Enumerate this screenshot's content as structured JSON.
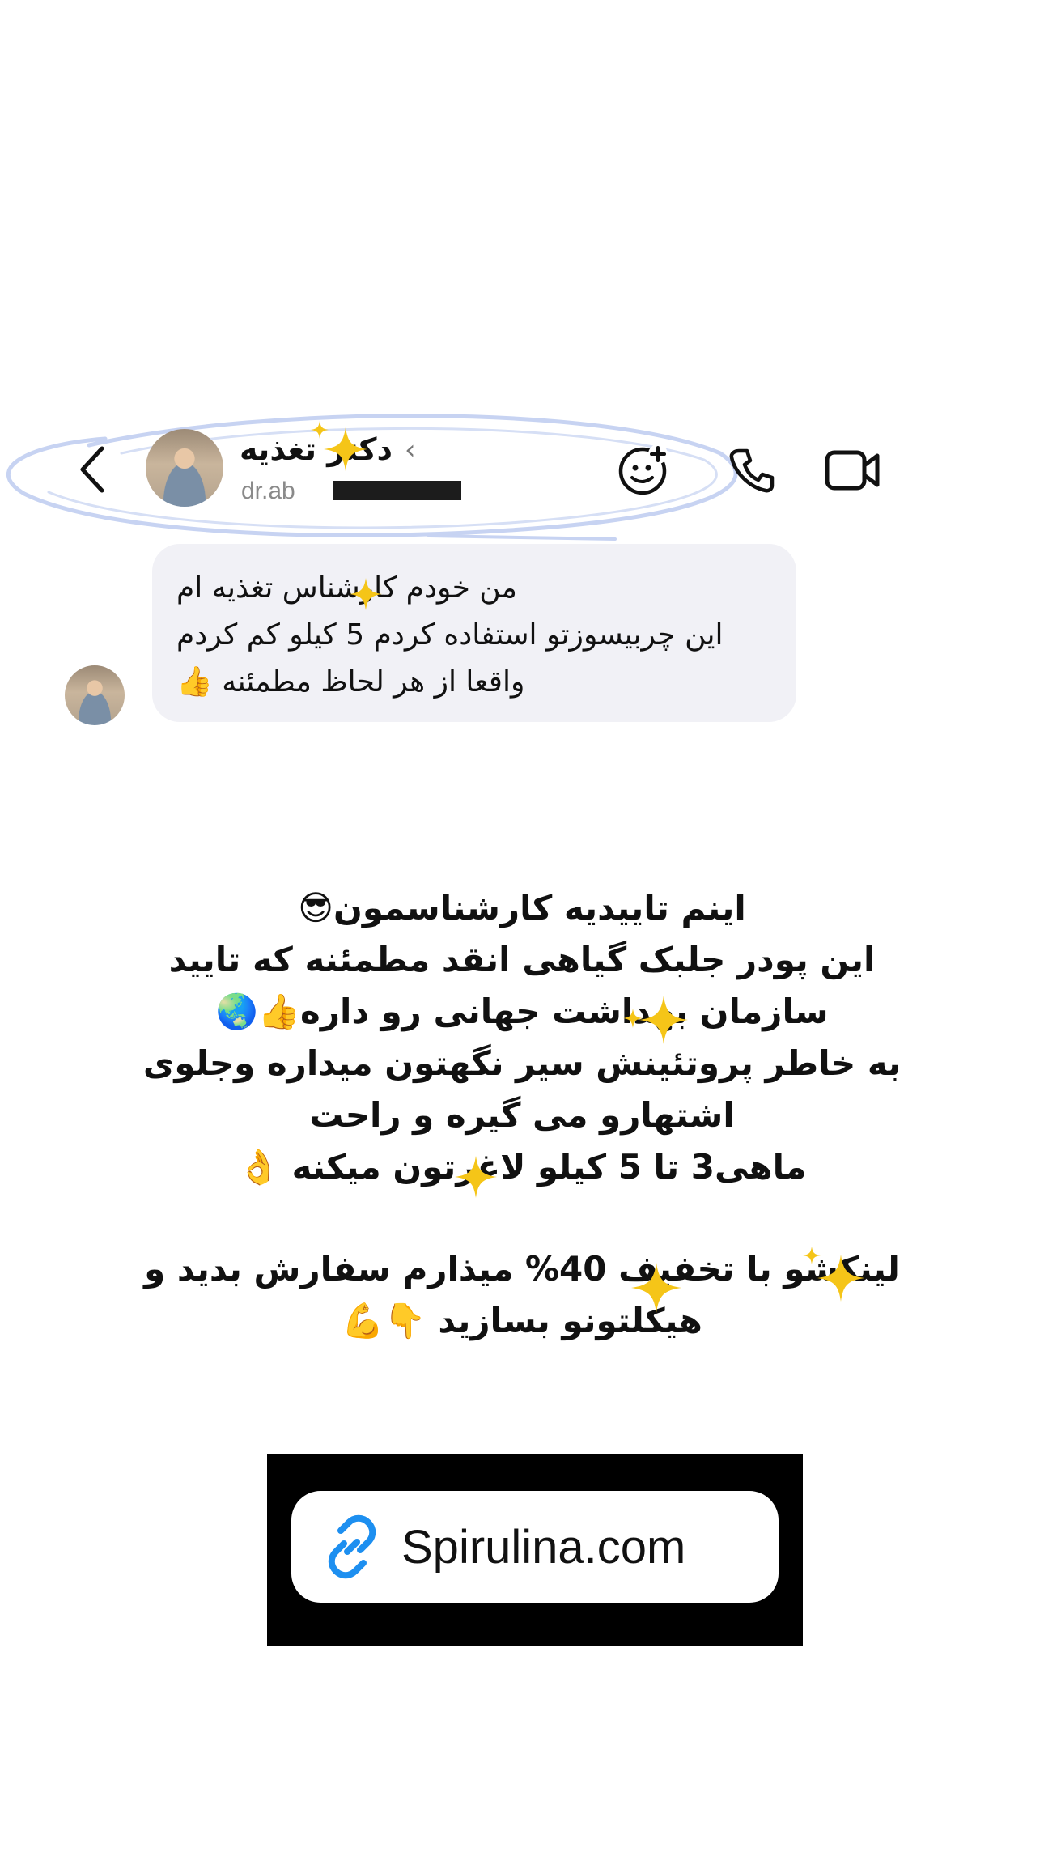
{
  "header": {
    "back_icon": "chevron-left-icon",
    "contact_name": "دکتر تغذیه",
    "name_chevron": "‹",
    "contact_handle": "dr.ab",
    "actions": {
      "sticker_icon": "sticker-add-icon",
      "call_icon": "phone-icon",
      "video_icon": "video-camera-icon"
    }
  },
  "message": {
    "lines": [
      "من خودم کارشناس تغذیه ام",
      "این چربیسوزتو استفاده کردم 5 کیلو کم کردم",
      "واقعا از هر لحاظ مطمئنه 👍"
    ]
  },
  "caption": {
    "lines": [
      "اینم تاییدیه کارشناسمون😎",
      "این پودر جلبک گیاهی انقد مطمئنه که تایید",
      "سازمان بهداشت جهانی رو داره👍🌏",
      "به خاطر پروتئینش سیر نگهتون میداره وجلوی",
      "اشتهارو می گیره و راحت",
      "ماهی3 تا 5 کیلو لاغرتون میکنه 👌",
      "لینکشو با تخفیف 40% میذارم سفارش بدید و",
      "هیکلتونو بسازید 👇💪"
    ]
  },
  "link": {
    "icon": "link-icon",
    "text": "Spirulina.com",
    "accent": "#1d8ff0"
  },
  "colors": {
    "bubble": "#f1f1f6",
    "sparkle": "#f5c518",
    "scribble": "#c7d3f2"
  }
}
